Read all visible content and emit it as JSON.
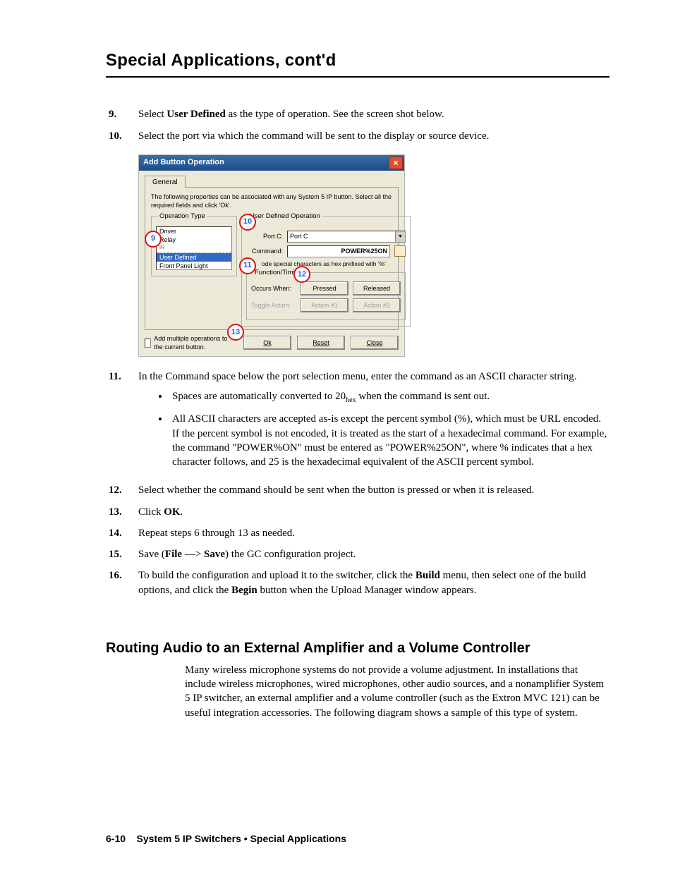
{
  "page_title": "Special Applications, cont'd",
  "steps": [
    {
      "num": "9.",
      "body_parts": [
        {
          "t": "Select ",
          "b": false
        },
        {
          "t": "User Defined",
          "b": true
        },
        {
          "t": " as the type of operation.  See the screen shot below.",
          "b": false
        }
      ]
    },
    {
      "num": "10.",
      "body_parts": [
        {
          "t": "Select the port via which the command will be sent to the display or source device.",
          "b": false
        }
      ]
    }
  ],
  "dialog": {
    "title": "Add Button Operation",
    "tab": "General",
    "intro": "The following properties can be associated with any System 5 IP button. Select all the required fields and click 'Ok'.",
    "optype_legend": "Operation Type",
    "optype_items": [
      "Driver",
      "Relay",
      "IR",
      "User Defined",
      "Front Panel Light Control"
    ],
    "selected_optype": "User Defined",
    "userop_legend": "User Defined Operation",
    "port_label": "Port C:",
    "port_value": "Port C",
    "cmd_label": "Command:",
    "cmd_value": "POWER%25ON",
    "hint": "ode special characters as hex prefixed with '%'",
    "ft_legend": "Function/Timing",
    "occurs_label": "Occurs When:",
    "pressed": "Pressed",
    "released": "Released",
    "toggle_label": "Toggle Action:",
    "action1": "Action #1",
    "action2": "Action #2",
    "multi": "Add multiple operations to the current button.",
    "ok": "Ok",
    "reset": "Reset",
    "close": "Close"
  },
  "callouts": {
    "c9": "9",
    "c10": "10",
    "c11": "11",
    "c12": "12",
    "c13": "13"
  },
  "step11": {
    "num": "11.",
    "body": "In the Command space below the port selection menu, enter the command as an ASCII character string.",
    "bullets": [
      "Spaces are automatically converted to 20hex when the command is sent out.",
      "All ASCII characters are accepted as-is except the percent symbol (%), which must be URL encoded.  If the percent symbol is not encoded, it is treated as the start of a hexadecimal command.  For example, the command \"POWER%ON\" must be entered as \"POWER%25ON\", where % indicates that a hex character follows, and 25 is the hexadecimal equivalent of the ASCII percent symbol."
    ]
  },
  "steps_after": [
    {
      "num": "12.",
      "body": "Select whether the command should be sent when the button is pressed or when it is released."
    },
    {
      "num": "13.",
      "parts": [
        {
          "t": "Click ",
          "b": false
        },
        {
          "t": "OK",
          "b": true
        },
        {
          "t": ".",
          "b": false
        }
      ]
    },
    {
      "num": "14.",
      "body": "Repeat steps 6 through 13 as needed."
    },
    {
      "num": "15.",
      "parts": [
        {
          "t": "Save (",
          "b": false
        },
        {
          "t": "File",
          "b": true
        },
        {
          "t": " —> ",
          "b": false
        },
        {
          "t": "Save",
          "b": true
        },
        {
          "t": ") the GC configuration project.",
          "b": false
        }
      ]
    },
    {
      "num": "16.",
      "parts": [
        {
          "t": "To build the configuration and upload it to the switcher, click the ",
          "b": false
        },
        {
          "t": "Build",
          "b": true
        },
        {
          "t": " menu, then select one of the build options, and click the ",
          "b": false
        },
        {
          "t": "Begin",
          "b": true
        },
        {
          "t": " button when the Upload Manager window appears.",
          "b": false
        }
      ]
    }
  ],
  "section": {
    "heading": "Routing Audio to an External Amplifier and a Volume Controller",
    "para": "Many wireless microphone systems do not provide a volume adjustment.  In installations that include wireless microphones, wired microphones, other audio sources, and a nonamplifier System 5 IP switcher, an external amplifier and a volume controller (such as the Extron MVC 121) can be useful integration accessories.  The following diagram shows a sample of this type of system."
  },
  "footer": {
    "page": "6-10",
    "label": "System 5 IP Switchers • Special Applications"
  }
}
